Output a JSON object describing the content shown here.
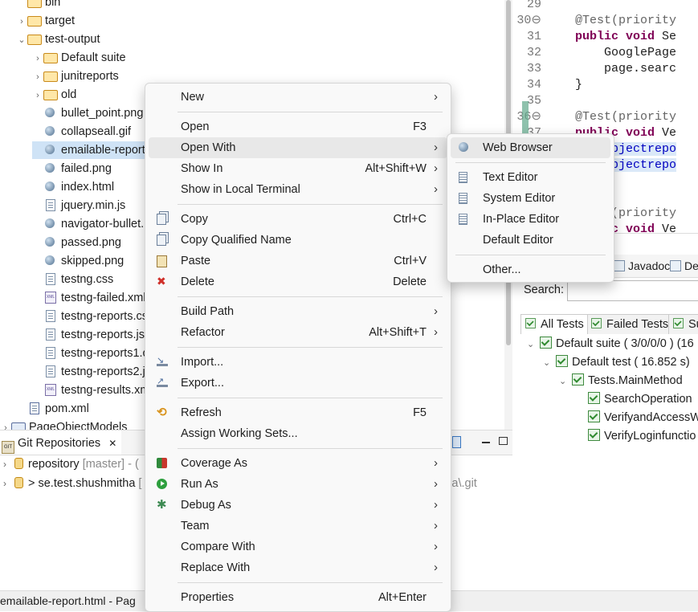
{
  "tree": {
    "items": [
      {
        "label": "bin",
        "kind": "folder",
        "indent": 1,
        "twisty": ""
      },
      {
        "label": "target",
        "kind": "folder",
        "indent": 1,
        "twisty": "›"
      },
      {
        "label": "test-output",
        "kind": "folder",
        "indent": 1,
        "twisty": "⌄"
      },
      {
        "label": "Default suite",
        "kind": "folder",
        "indent": 2,
        "twisty": "›"
      },
      {
        "label": "junitreports",
        "kind": "folder",
        "indent": 2,
        "twisty": "›"
      },
      {
        "label": "old",
        "kind": "folder",
        "indent": 2,
        "twisty": "›"
      },
      {
        "label": "bullet_point.png",
        "kind": "image",
        "indent": 2,
        "twisty": ""
      },
      {
        "label": "collapseall.gif",
        "kind": "image",
        "indent": 2,
        "twisty": ""
      },
      {
        "label": "emailable-report.html",
        "kind": "image",
        "indent": 2,
        "twisty": "",
        "selected": true
      },
      {
        "label": "failed.png",
        "kind": "image",
        "indent": 2,
        "twisty": ""
      },
      {
        "label": "index.html",
        "kind": "image",
        "indent": 2,
        "twisty": ""
      },
      {
        "label": "jquery.min.js",
        "kind": "doc",
        "indent": 2,
        "twisty": ""
      },
      {
        "label": "navigator-bullet.png",
        "kind": "image",
        "indent": 2,
        "twisty": ""
      },
      {
        "label": "passed.png",
        "kind": "image",
        "indent": 2,
        "twisty": ""
      },
      {
        "label": "skipped.png",
        "kind": "image",
        "indent": 2,
        "twisty": ""
      },
      {
        "label": "testng.css",
        "kind": "doc",
        "indent": 2,
        "twisty": ""
      },
      {
        "label": "testng-failed.xml",
        "kind": "xml",
        "indent": 2,
        "twisty": ""
      },
      {
        "label": "testng-reports.css",
        "kind": "doc",
        "indent": 2,
        "twisty": ""
      },
      {
        "label": "testng-reports.js",
        "kind": "doc",
        "indent": 2,
        "twisty": ""
      },
      {
        "label": "testng-reports1.css",
        "kind": "doc",
        "indent": 2,
        "twisty": ""
      },
      {
        "label": "testng-reports2.js",
        "kind": "doc",
        "indent": 2,
        "twisty": ""
      },
      {
        "label": "testng-results.xml",
        "kind": "xml",
        "indent": 2,
        "twisty": ""
      },
      {
        "label": "pom.xml",
        "kind": "pom",
        "indent": 1,
        "twisty": ""
      },
      {
        "label": "PageObjectModels",
        "kind": "project",
        "indent": 0,
        "twisty": "›"
      }
    ]
  },
  "editor": {
    "lines": [
      {
        "n": "29",
        "segs": [
          {
            "t": ""
          }
        ]
      },
      {
        "n": "30⊖",
        "segs": [
          {
            "t": "    "
          },
          {
            "t": "@Test(priority",
            "c": "an"
          }
        ]
      },
      {
        "n": "31",
        "segs": [
          {
            "t": "    "
          },
          {
            "t": "public void ",
            "c": "kw"
          },
          {
            "t": "Se"
          }
        ]
      },
      {
        "n": "32",
        "segs": [
          {
            "t": "        GooglePage"
          }
        ]
      },
      {
        "n": "33",
        "segs": [
          {
            "t": "        page.searc"
          }
        ]
      },
      {
        "n": "34",
        "segs": [
          {
            "t": "    }"
          }
        ]
      },
      {
        "n": "35",
        "segs": [
          {
            "t": ""
          }
        ]
      },
      {
        "n": "36⊖",
        "segs": [
          {
            "t": "    "
          },
          {
            "t": "@Test(priority",
            "c": "an"
          }
        ]
      },
      {
        "n": "37",
        "segs": [
          {
            "t": "    "
          },
          {
            "t": "public void ",
            "c": "kw"
          },
          {
            "t": "Ve"
          }
        ]
      },
      {
        "n": "38",
        "segs": [
          {
            "t": "        "
          },
          {
            "t": "objectrepo",
            "c": "fld"
          }
        ],
        "hl": true
      },
      {
        "n": "39",
        "segs": [
          {
            "t": "        "
          },
          {
            "t": "objectrepo",
            "c": "fld"
          }
        ],
        "hl": true
      },
      {
        "n": "40",
        "segs": [
          {
            "t": "    }"
          }
        ]
      },
      {
        "n": "41",
        "segs": [
          {
            "t": ""
          }
        ]
      },
      {
        "n": "42⊖",
        "segs": [
          {
            "t": "    "
          },
          {
            "t": "@Test(priority",
            "c": "an"
          }
        ]
      },
      {
        "n": "43",
        "segs": [
          {
            "t": "    "
          },
          {
            "t": "public void ",
            "c": "kw"
          },
          {
            "t": "Ve"
          }
        ]
      }
    ]
  },
  "right_panel": {
    "tabs": [
      "Javadoc",
      "Dec"
    ],
    "search_label": "Search:",
    "test_tabs": [
      "All Tests",
      "Failed Tests",
      "Summ"
    ],
    "results": [
      {
        "label": "Default suite ( 3/0/0/0 ) (16",
        "indent": 0,
        "twisty": "⌄"
      },
      {
        "label": "Default test ( 16.852 s)",
        "indent": 1,
        "twisty": "⌄"
      },
      {
        "label": "Tests.MainMethod",
        "indent": 2,
        "twisty": "⌄"
      },
      {
        "label": "SearchOperation",
        "indent": 3,
        "twisty": ""
      },
      {
        "label": "VerifyandAccessW",
        "indent": 3,
        "twisty": ""
      },
      {
        "label": "VerifyLoginfunctio",
        "indent": 3,
        "twisty": ""
      }
    ]
  },
  "git": {
    "tab_label": "Git Repositories",
    "close": "✕",
    "rows": [
      {
        "name": "repository",
        "branch": "[master]",
        "tail": "- ("
      },
      {
        "name": "> se.test.shushmitha",
        "branch": "[",
        "tail": ""
      }
    ],
    "path_fragment": "mitha\\.git"
  },
  "status_text": "emailable-report.html - Pag",
  "context_menu": {
    "items": [
      {
        "label": "New",
        "accel": "",
        "submenu": true
      },
      {
        "sep": true
      },
      {
        "label": "Open",
        "accel": "F3",
        "submenu": false
      },
      {
        "label": "Open With",
        "accel": "",
        "submenu": true,
        "hover": true
      },
      {
        "label": "Show In",
        "accel": "Alt+Shift+W",
        "submenu": true
      },
      {
        "label": "Show in Local Terminal",
        "accel": "",
        "submenu": true
      },
      {
        "sep": true
      },
      {
        "label": "Copy",
        "accel": "Ctrl+C",
        "submenu": false,
        "icon": "copy-icon"
      },
      {
        "label": "Copy Qualified Name",
        "accel": "",
        "submenu": false,
        "icon": "copy-qualified-icon"
      },
      {
        "label": "Paste",
        "accel": "Ctrl+V",
        "submenu": false,
        "icon": "paste-icon"
      },
      {
        "label": "Delete",
        "accel": "Delete",
        "submenu": false,
        "icon": "delete-icon"
      },
      {
        "sep": true
      },
      {
        "label": "Build Path",
        "accel": "",
        "submenu": true
      },
      {
        "label": "Refactor",
        "accel": "Alt+Shift+T",
        "submenu": true
      },
      {
        "sep": true
      },
      {
        "label": "Import...",
        "accel": "",
        "submenu": false,
        "icon": "import-icon"
      },
      {
        "label": "Export...",
        "accel": "",
        "submenu": false,
        "icon": "export-icon"
      },
      {
        "sep": true
      },
      {
        "label": "Refresh",
        "accel": "F5",
        "submenu": false,
        "icon": "refresh-icon"
      },
      {
        "label": "Assign Working Sets...",
        "accel": "",
        "submenu": false
      },
      {
        "sep": true
      },
      {
        "label": "Coverage As",
        "accel": "",
        "submenu": true,
        "icon": "coverage-icon"
      },
      {
        "label": "Run As",
        "accel": "",
        "submenu": true,
        "icon": "run-icon"
      },
      {
        "label": "Debug As",
        "accel": "",
        "submenu": true,
        "icon": "debug-icon"
      },
      {
        "label": "Team",
        "accel": "",
        "submenu": true
      },
      {
        "label": "Compare With",
        "accel": "",
        "submenu": true
      },
      {
        "label": "Replace With",
        "accel": "",
        "submenu": true
      },
      {
        "sep": true
      },
      {
        "label": "Properties",
        "accel": "Alt+Enter",
        "submenu": false
      }
    ]
  },
  "submenu": {
    "items": [
      {
        "label": "Web Browser",
        "icon": "web-browser-icon",
        "hover": true
      },
      {
        "sep": true
      },
      {
        "label": "Text Editor",
        "icon": "text-editor-icon"
      },
      {
        "label": "System Editor",
        "icon": "system-editor-icon"
      },
      {
        "label": "In-Place Editor",
        "icon": "in-place-editor-icon"
      },
      {
        "label": "Default Editor",
        "icon": ""
      },
      {
        "sep": true
      },
      {
        "label": "Other...",
        "icon": ""
      }
    ]
  },
  "colors": {
    "selection": "#cfe3f6",
    "menu_hover": "#e8e8e8",
    "keyword": "#7f0055",
    "field": "#0000c0"
  }
}
